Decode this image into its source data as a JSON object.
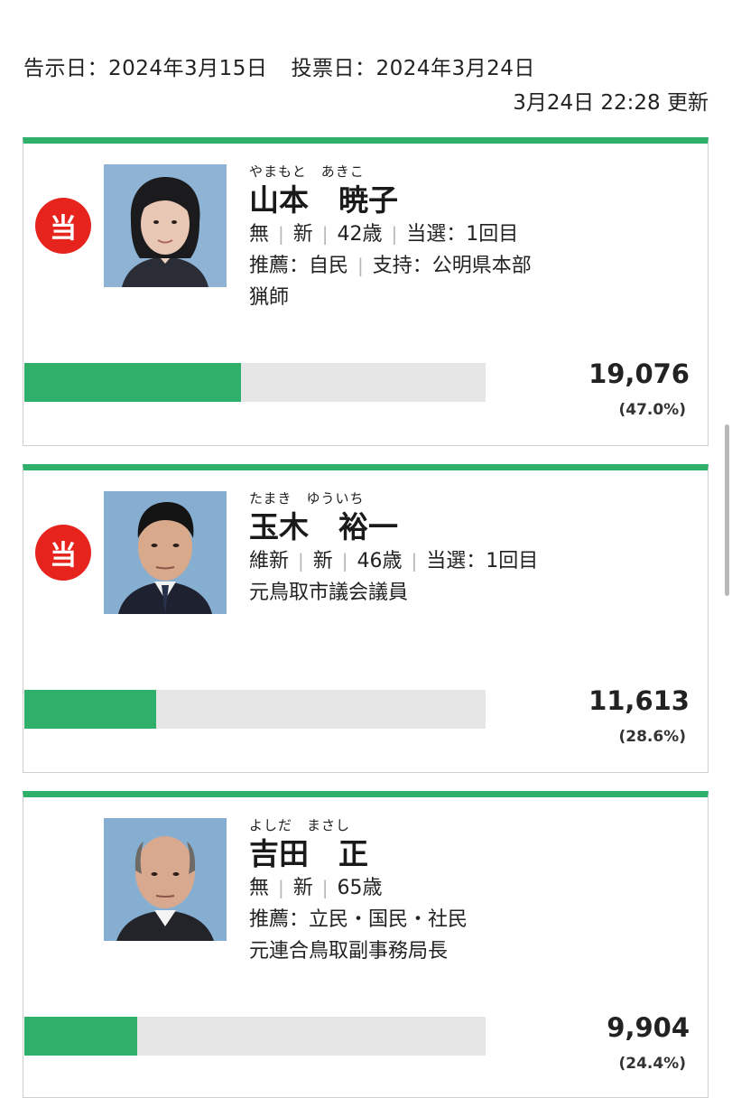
{
  "header": {
    "notice_date": "告示日：2024年3月15日",
    "vote_date": "投票日：2024年3月24日",
    "updated": "3月24日 22:28 更新"
  },
  "colors": {
    "accent": "#2fb06a",
    "elected_badge": "#e6241d",
    "bar_track": "#e6e6e6"
  },
  "candidates": [
    {
      "elected_label": "当",
      "kana": "やまもと　あきこ",
      "name": "山本　暁子",
      "party": "無",
      "status": "新",
      "age": "42歳",
      "terms": "当選：1回目",
      "endorse": "推薦：自民",
      "support": "支持：公明県本部",
      "career": "猟師",
      "votes": "19,076",
      "percent": "(47.0%)",
      "share": 0.47,
      "photo_icon": "female-candidate-photo"
    },
    {
      "elected_label": "当",
      "kana": "たまき　ゆういち",
      "name": "玉木　裕一",
      "party": "維新",
      "status": "新",
      "age": "46歳",
      "terms": "当選：1回目",
      "career": "元鳥取市議会議員",
      "votes": "11,613",
      "percent": "(28.6%)",
      "share": 0.286,
      "photo_icon": "male-candidate-photo"
    },
    {
      "kana": "よしだ　まさし",
      "name": "吉田　正",
      "party": "無",
      "status": "新",
      "age": "65歳",
      "endorse": "推薦：立民・国民・社民",
      "career": "元連合鳥取副事務局長",
      "votes": "9,904",
      "percent": "(24.4%)",
      "share": 0.244,
      "photo_icon": "male-candidate-photo"
    }
  ]
}
